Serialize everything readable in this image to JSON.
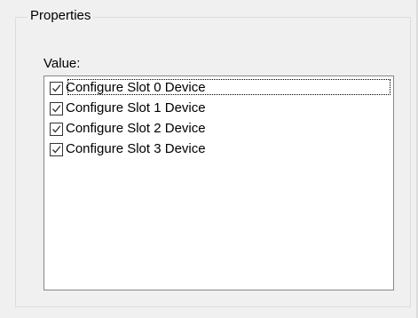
{
  "group": {
    "title": "Properties"
  },
  "value_label": "Value:",
  "list": {
    "items": [
      {
        "label": "Configure Slot 0 Device",
        "checked": true
      },
      {
        "label": "Configure Slot 1 Device",
        "checked": true
      },
      {
        "label": "Configure Slot 2 Device",
        "checked": true
      },
      {
        "label": "Configure Slot 3 Device",
        "checked": true
      }
    ]
  },
  "icons": {
    "checkbox_check": "checkmark-icon"
  },
  "colors": {
    "window_bg": "#f0f0f0",
    "list_bg": "#ffffff",
    "list_border": "#828790"
  }
}
